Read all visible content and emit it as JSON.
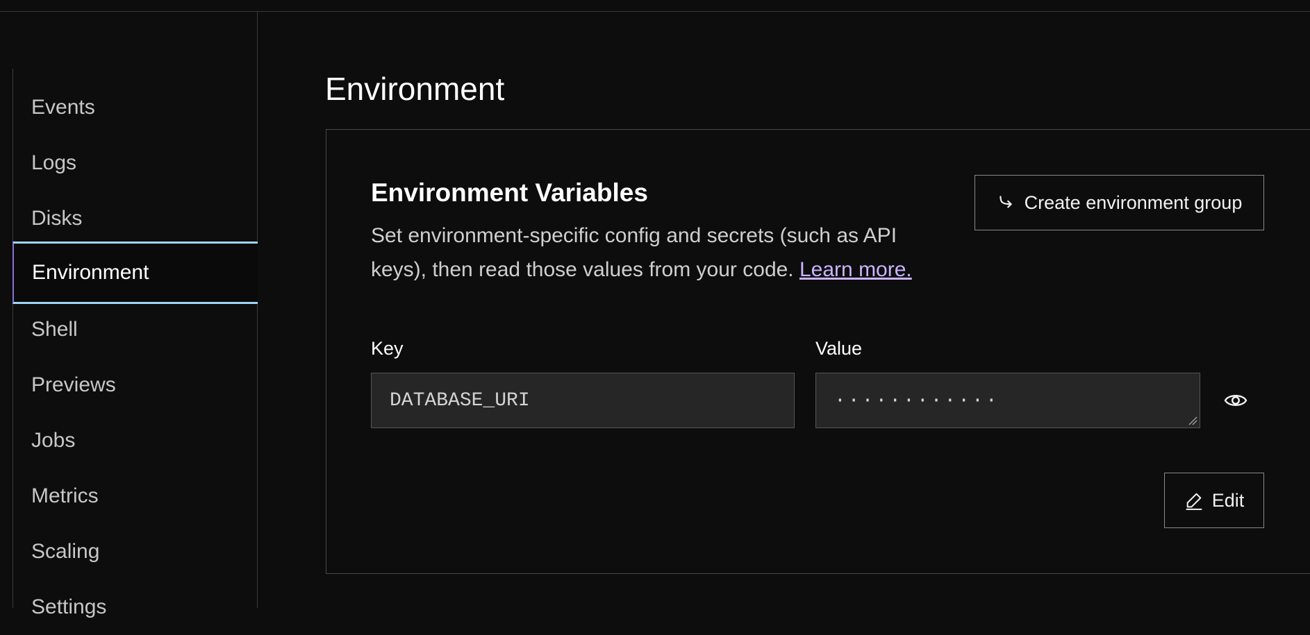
{
  "sidebar": {
    "items": [
      {
        "label": "Events"
      },
      {
        "label": "Logs"
      },
      {
        "label": "Disks"
      },
      {
        "label": "Environment",
        "active": true
      },
      {
        "label": "Shell"
      },
      {
        "label": "Previews"
      },
      {
        "label": "Jobs"
      },
      {
        "label": "Metrics"
      },
      {
        "label": "Scaling"
      },
      {
        "label": "Settings"
      }
    ]
  },
  "main": {
    "title": "Environment",
    "card": {
      "title": "Environment Variables",
      "description": "Set environment-specific config and secrets (such as API keys), then read those values from your code.",
      "link_text": "Learn more.",
      "create_button": {
        "label": "Create environment group",
        "icon": "arrow-hook-right-icon"
      },
      "key_label": "Key",
      "value_label": "Value",
      "key_value": "DATABASE_URI",
      "value_masked": "············",
      "reveal_icon": "eye-icon",
      "edit_button": {
        "label": "Edit",
        "icon": "pencil-icon"
      }
    }
  },
  "colors": {
    "background": "#0d0d0d",
    "active_border": "#9fd6f5",
    "active_left": "#8a6fd8",
    "link": "#c9b3ff"
  }
}
